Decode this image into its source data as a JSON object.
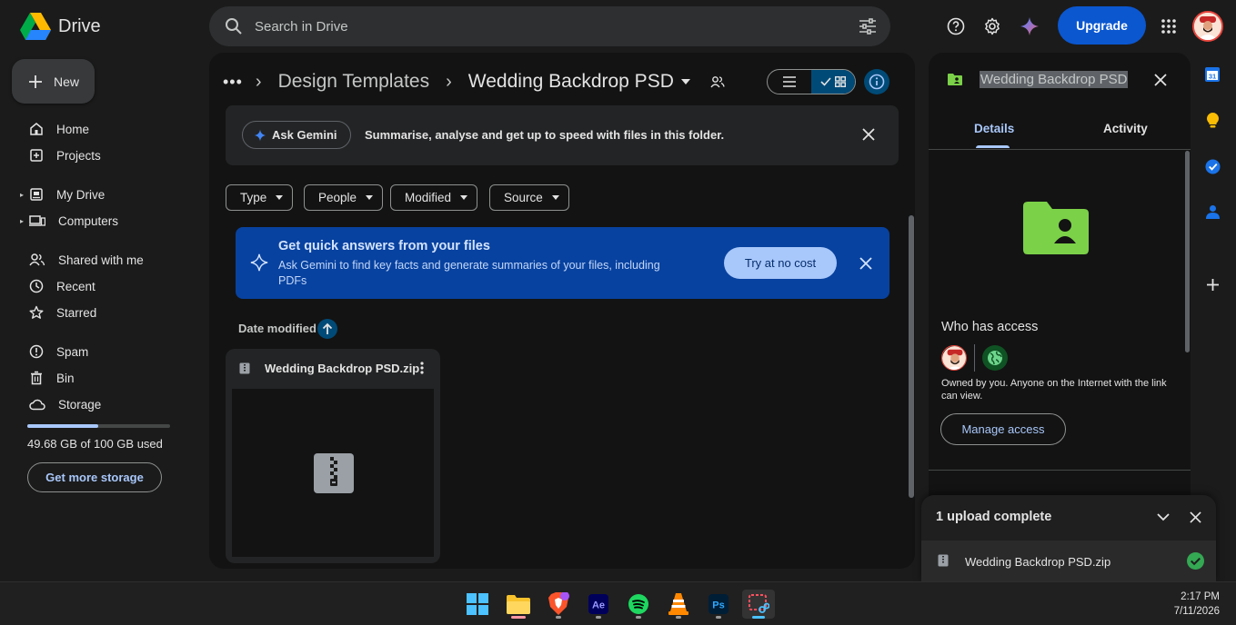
{
  "app": {
    "brand": "Drive"
  },
  "search": {
    "placeholder": "Search in Drive"
  },
  "header": {
    "upgrade_label": "Upgrade"
  },
  "sidebar": {
    "new_label": "New",
    "items": [
      {
        "label": "Home"
      },
      {
        "label": "Projects"
      },
      {
        "label": "My Drive"
      },
      {
        "label": "Computers"
      },
      {
        "label": "Shared with me"
      },
      {
        "label": "Recent"
      },
      {
        "label": "Starred"
      },
      {
        "label": "Spam"
      },
      {
        "label": "Bin"
      },
      {
        "label": "Storage"
      }
    ],
    "storage_used_fraction": 0.4968,
    "storage_text": "49.68 GB of 100 GB used",
    "get_more_label": "Get more storage"
  },
  "breadcrumb": {
    "parent": "Design Templates",
    "current": "Wedding Backdrop PSD"
  },
  "gemini_bar": {
    "ask_label": "Ask Gemini",
    "text": "Summarise, analyse and get up to speed with files in this folder."
  },
  "filters": [
    {
      "label": "Type"
    },
    {
      "label": "People"
    },
    {
      "label": "Modified"
    },
    {
      "label": "Source"
    }
  ],
  "promo": {
    "title": "Get quick answers from your files",
    "desc": "Ask Gemini to find key facts and generate summaries of your files, including PDFs",
    "cta": "Try at no cost"
  },
  "sort": {
    "label": "Date modified"
  },
  "files": [
    {
      "name": "Wedding Backdrop PSD.zip"
    }
  ],
  "details": {
    "title": "Wedding Backdrop PSD",
    "tabs": [
      {
        "label": "Details"
      },
      {
        "label": "Activity"
      }
    ],
    "who_has_access": "Who has access",
    "owned_text": "Owned by you. Anyone on the Internet with the link can view.",
    "manage_label": "Manage access"
  },
  "upload": {
    "title": "1 upload complete",
    "file": "Wedding Backdrop PSD.zip"
  },
  "taskbar": {
    "time": "2:17 PM",
    "date": "7/11/2026"
  },
  "colors": {
    "accent": "#a8c7fa",
    "primary": "#0b57d0",
    "folder_green": "#7bd148",
    "success": "#34a853"
  }
}
